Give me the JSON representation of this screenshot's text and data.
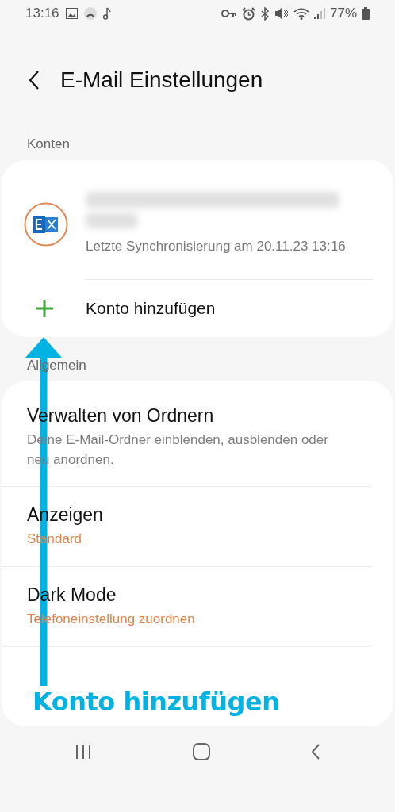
{
  "status_bar": {
    "time": "13:16",
    "battery": "77%"
  },
  "header": {
    "title": "E-Mail Einstellungen"
  },
  "accounts": {
    "label": "Konten",
    "items": [
      {
        "kind": "account",
        "sync": "Letzte Synchronisierung am 20.11.23 13:16"
      },
      {
        "kind": "add",
        "label": "Konto hinzufügen"
      }
    ]
  },
  "general": {
    "label": "Allgemein",
    "items": [
      {
        "title": "Verwalten von Ordnern",
        "subtitle": "Deine E-Mail-Ordner einblenden, ausblenden oder neu anordnen.",
        "kind": "description"
      },
      {
        "title": "Anzeigen",
        "subtitle": "Standard",
        "kind": "value"
      },
      {
        "title": "Dark Mode",
        "subtitle": "Telefoneinstellung zuordnen",
        "kind": "value"
      }
    ]
  },
  "annotation": {
    "label": "Konto hinzufügen"
  }
}
